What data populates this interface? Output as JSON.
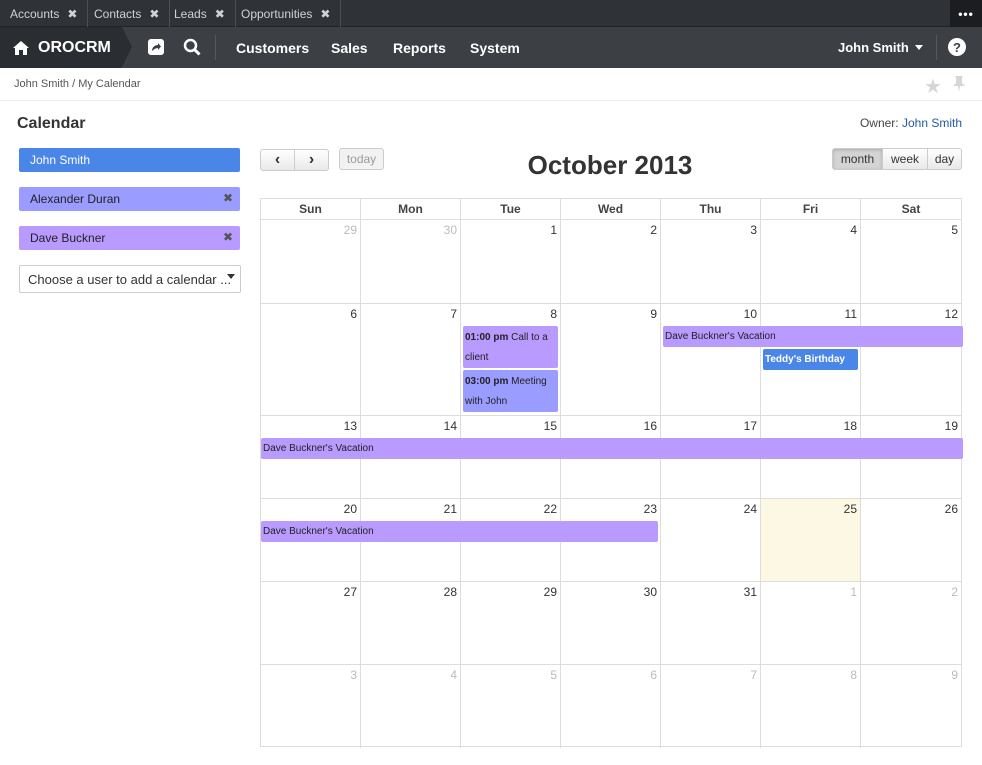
{
  "tabs": [
    {
      "label": "Accounts"
    },
    {
      "label": "Contacts"
    },
    {
      "label": "Leads"
    },
    {
      "label": "Opportunities"
    }
  ],
  "tabs_more": "•••",
  "brand": "OROCRM",
  "nav": {
    "customers": "Customers",
    "sales": "Sales",
    "reports": "Reports",
    "system": "System"
  },
  "user_menu": "John Smith",
  "help": "?",
  "breadcrumb": "John Smith / My Calendar",
  "page_title": "Calendar",
  "owner": {
    "label": "Owner:",
    "name": "John Smith"
  },
  "calendars": [
    {
      "name": "John Smith",
      "color": "#4a86e8"
    },
    {
      "name": "Alexander Duran",
      "color": "#9a9cff"
    },
    {
      "name": "Dave Buckner",
      "color": "#b99aff"
    }
  ],
  "choose_user_placeholder": "Choose a user to add a calendar ...",
  "controls": {
    "prev": "‹",
    "next": "›",
    "today": "today",
    "month": "month",
    "week": "week",
    "day": "day"
  },
  "month_title": "October 2013",
  "weekdays": [
    "Sun",
    "Mon",
    "Tue",
    "Wed",
    "Thu",
    "Fri",
    "Sat"
  ],
  "weeks": [
    [
      {
        "d": "29",
        "other": true
      },
      {
        "d": "30",
        "other": true
      },
      {
        "d": "1"
      },
      {
        "d": "2"
      },
      {
        "d": "3"
      },
      {
        "d": "4"
      },
      {
        "d": "5"
      }
    ],
    [
      {
        "d": "6"
      },
      {
        "d": "7"
      },
      {
        "d": "8"
      },
      {
        "d": "9"
      },
      {
        "d": "10"
      },
      {
        "d": "11"
      },
      {
        "d": "12"
      }
    ],
    [
      {
        "d": "13"
      },
      {
        "d": "14"
      },
      {
        "d": "15"
      },
      {
        "d": "16"
      },
      {
        "d": "17"
      },
      {
        "d": "18"
      },
      {
        "d": "19"
      }
    ],
    [
      {
        "d": "20"
      },
      {
        "d": "21"
      },
      {
        "d": "22"
      },
      {
        "d": "23"
      },
      {
        "d": "24"
      },
      {
        "d": "25",
        "today": true
      },
      {
        "d": "26"
      }
    ],
    [
      {
        "d": "27"
      },
      {
        "d": "28"
      },
      {
        "d": "29"
      },
      {
        "d": "30"
      },
      {
        "d": "31"
      },
      {
        "d": "1",
        "other": true
      },
      {
        "d": "2",
        "other": true
      }
    ],
    [
      {
        "d": "3",
        "other": true
      },
      {
        "d": "4",
        "other": true
      },
      {
        "d": "5",
        "other": true
      },
      {
        "d": "6",
        "other": true
      },
      {
        "d": "7",
        "other": true
      },
      {
        "d": "8",
        "other": true
      },
      {
        "d": "9",
        "other": true
      }
    ]
  ],
  "events": [
    {
      "time": "01:00 pm",
      "title": "Call to a client",
      "color": "#b99aff"
    },
    {
      "time": "03:00 pm",
      "title": "Meeting with John",
      "color": "#9a9cff"
    },
    {
      "time": "",
      "title": "Dave Buckner's Vacation",
      "color": "#b99aff"
    },
    {
      "time": "",
      "title": "Teddy's Birthday",
      "color": "#4a86e8"
    },
    {
      "time": "",
      "title": "Dave Buckner's Vacation",
      "color": "#b99aff"
    },
    {
      "time": "",
      "title": "Dave Buckner's Vacation",
      "color": "#b99aff"
    }
  ]
}
